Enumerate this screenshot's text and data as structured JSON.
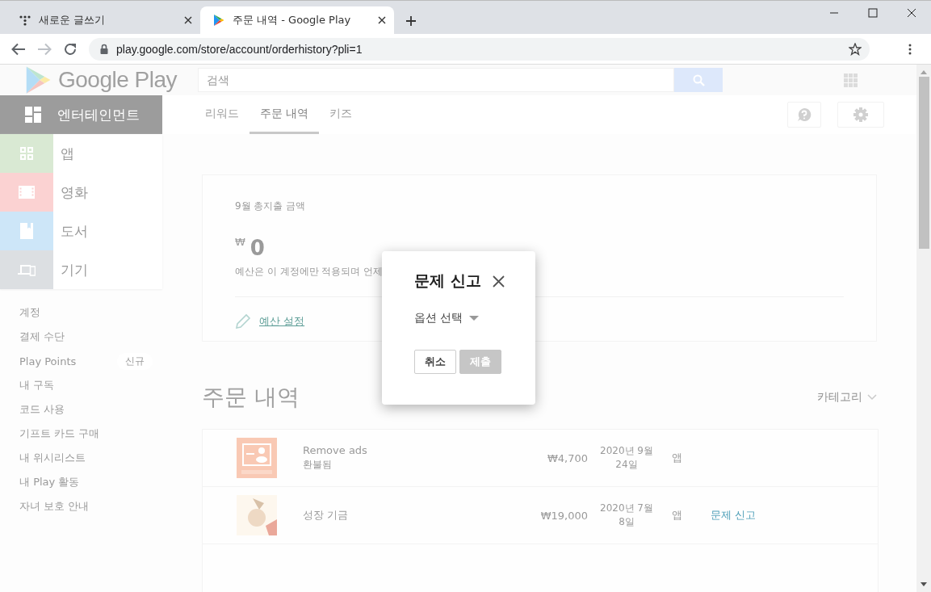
{
  "browser": {
    "tabs": [
      {
        "title": "새로운 글쓰기",
        "selected": false
      },
      {
        "title": "주문 내역 - Google Play",
        "selected": true
      }
    ],
    "url": "play.google.com/store/account/orderhistory?pli=1"
  },
  "header": {
    "logo": "Google Play",
    "search": {
      "placeholder": "검색"
    }
  },
  "sidebar": {
    "section": "엔터테인먼트",
    "categories": [
      {
        "label": "앱",
        "color": "#d9e9d3"
      },
      {
        "label": "영화",
        "color": "#fbd2d2"
      },
      {
        "label": "도서",
        "color": "#cde6f8"
      },
      {
        "label": "기기",
        "color": "#dcdfe2"
      }
    ],
    "links": [
      {
        "label": "계정"
      },
      {
        "label": "결제 수단"
      },
      {
        "label": "Play Points",
        "badge": "신규"
      },
      {
        "label": "내 구독"
      },
      {
        "label": "코드 사용"
      },
      {
        "label": "기프트 카드 구매"
      },
      {
        "label": "내 위시리스트"
      },
      {
        "label": "내 Play 활동"
      },
      {
        "label": "자녀 보호 안내"
      }
    ]
  },
  "nav_tabs": [
    {
      "label": "리워드",
      "selected": false
    },
    {
      "label": "주문 내역",
      "selected": true
    },
    {
      "label": "키즈",
      "selected": false
    }
  ],
  "budget": {
    "title": "9월 총지출 금액",
    "currency": "₩",
    "amount": "0",
    "note": "예산은 이 계정에만 적용되며 언제",
    "link": "예산 설정"
  },
  "orders": {
    "title": "주문 내역",
    "filter": "카테고리",
    "rows": [
      {
        "name": "Remove ads",
        "status": "환불됨",
        "price": "₩4,700",
        "date": "2020년 9월 24일",
        "category": "앱"
      },
      {
        "name": "성장 기금",
        "price": "₩19,000",
        "date": "2020년 7월 8일",
        "category": "앱",
        "action": "문제 신고"
      }
    ]
  },
  "dialog": {
    "title": "문제 신고",
    "select": {
      "placeholder": "옵션 선택"
    },
    "buttons": [
      {
        "label": "취소",
        "disabled": false
      },
      {
        "label": "제출",
        "disabled": true
      }
    ]
  }
}
